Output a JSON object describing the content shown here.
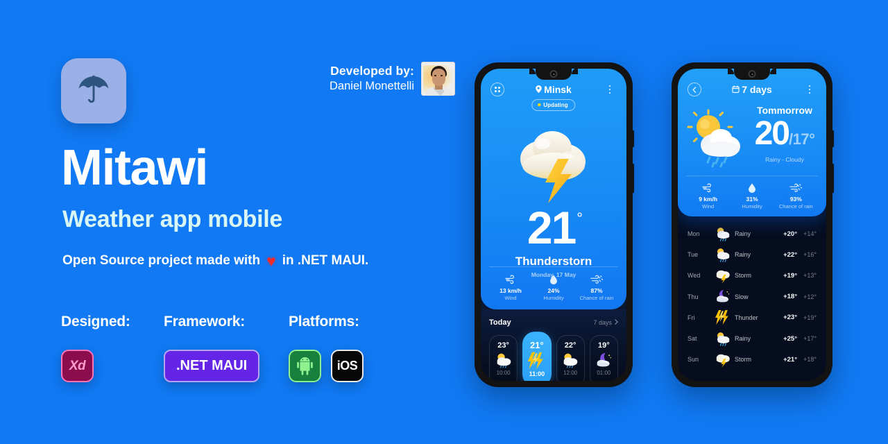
{
  "brand": {
    "logo_icon": "umbrella-icon",
    "title": "Mitawi",
    "subtitle": "Weather app mobile",
    "tagline_before": "Open Source project made with",
    "tagline_heart": "♥",
    "tagline_after": "in .NET MAUI."
  },
  "developer": {
    "label": "Developed by:",
    "name": "Daniel Monettelli",
    "avatar_icon": "avatar"
  },
  "meta_columns": [
    {
      "heading": "Designed:",
      "badges": [
        {
          "label": "Xd",
          "kind": "xd",
          "color": "#8c0d4e"
        }
      ]
    },
    {
      "heading": "Framework:",
      "badges": [
        {
          "label": ".NET MAUI",
          "kind": "maui",
          "color": "#6425e8"
        }
      ]
    },
    {
      "heading": "Platforms:",
      "badges": [
        {
          "label": "Android",
          "kind": "android",
          "color": "#16803c"
        },
        {
          "label": "iOS",
          "kind": "ios",
          "color": "#070707"
        }
      ]
    }
  ],
  "phone_today": {
    "header": {
      "left_icon": "grid-icon",
      "location_icon": "location-pin-icon",
      "title": "Minsk",
      "menu_icon": "kebab-menu-icon"
    },
    "status_badge": "Updating",
    "hero_icon": "thunderstorm-cloud-icon",
    "temperature": "21",
    "degree": "°",
    "condition": "Thunderstorn",
    "date": "Monday, 17 May",
    "stats": [
      {
        "icon": "wind-icon",
        "value": "13 km/h",
        "name": "Wind"
      },
      {
        "icon": "humidity-drop-icon",
        "value": "24%",
        "name": "Humidity"
      },
      {
        "icon": "rain-chance-icon",
        "value": "87%",
        "name": "Chance of rain"
      }
    ],
    "section_title": "Today",
    "section_link": "7 days",
    "hours": [
      {
        "temp": "23°",
        "icon": "sun-cloud-icon",
        "time": "10:00",
        "active": false
      },
      {
        "temp": "21°",
        "icon": "lightning-icon",
        "time": "11:00",
        "active": true
      },
      {
        "temp": "22°",
        "icon": "sun-cloud-icon",
        "time": "12:00",
        "active": false
      },
      {
        "temp": "19°",
        "icon": "moon-cloud-icon",
        "time": "01:00",
        "active": false
      }
    ]
  },
  "phone_week": {
    "header": {
      "back_icon": "chevron-left-icon",
      "calendar_icon": "calendar-icon",
      "title": "7 days",
      "menu_icon": "kebab-menu-icon"
    },
    "hero": {
      "icon": "sun-rain-cloud-icon",
      "label": "Tommorrow",
      "high": "20",
      "low": "/17°",
      "description": "Rainy - Cloudy"
    },
    "stats": [
      {
        "icon": "wind-icon",
        "value": "9 km/h",
        "name": "Wind"
      },
      {
        "icon": "humidity-drop-icon",
        "value": "31%",
        "name": "Humidity"
      },
      {
        "icon": "rain-chance-icon",
        "value": "93%",
        "name": "Chance of rain"
      }
    ],
    "days": [
      {
        "day": "Mon",
        "icon": "sun-rain-cloud-icon",
        "condition": "Rainy",
        "high": "+20°",
        "low": "+14°"
      },
      {
        "day": "Tue",
        "icon": "sun-rain-cloud-icon",
        "condition": "Rainy",
        "high": "+22°",
        "low": "+16°"
      },
      {
        "day": "Wed",
        "icon": "storm-cloud-icon",
        "condition": "Storm",
        "high": "+19°",
        "low": "+13°"
      },
      {
        "day": "Thu",
        "icon": "moon-cloud-icon",
        "condition": "Slow",
        "high": "+18°",
        "low": "+12°"
      },
      {
        "day": "Fri",
        "icon": "lightning-icon",
        "condition": "Thunder",
        "high": "+23°",
        "low": "+19°"
      },
      {
        "day": "Sat",
        "icon": "sun-rain-cloud-icon",
        "condition": "Rainy",
        "high": "+25°",
        "low": "+17°"
      },
      {
        "day": "Sun",
        "icon": "storm-cloud-icon",
        "condition": "Storm",
        "high": "+21°",
        "low": "+18°"
      }
    ]
  },
  "colors": {
    "background": "#1079f3",
    "accent_sky": "#2a9ef9",
    "dark_panel": "#071226",
    "subtitle": "#d9f6f7",
    "heart": "#ef2b2b"
  }
}
